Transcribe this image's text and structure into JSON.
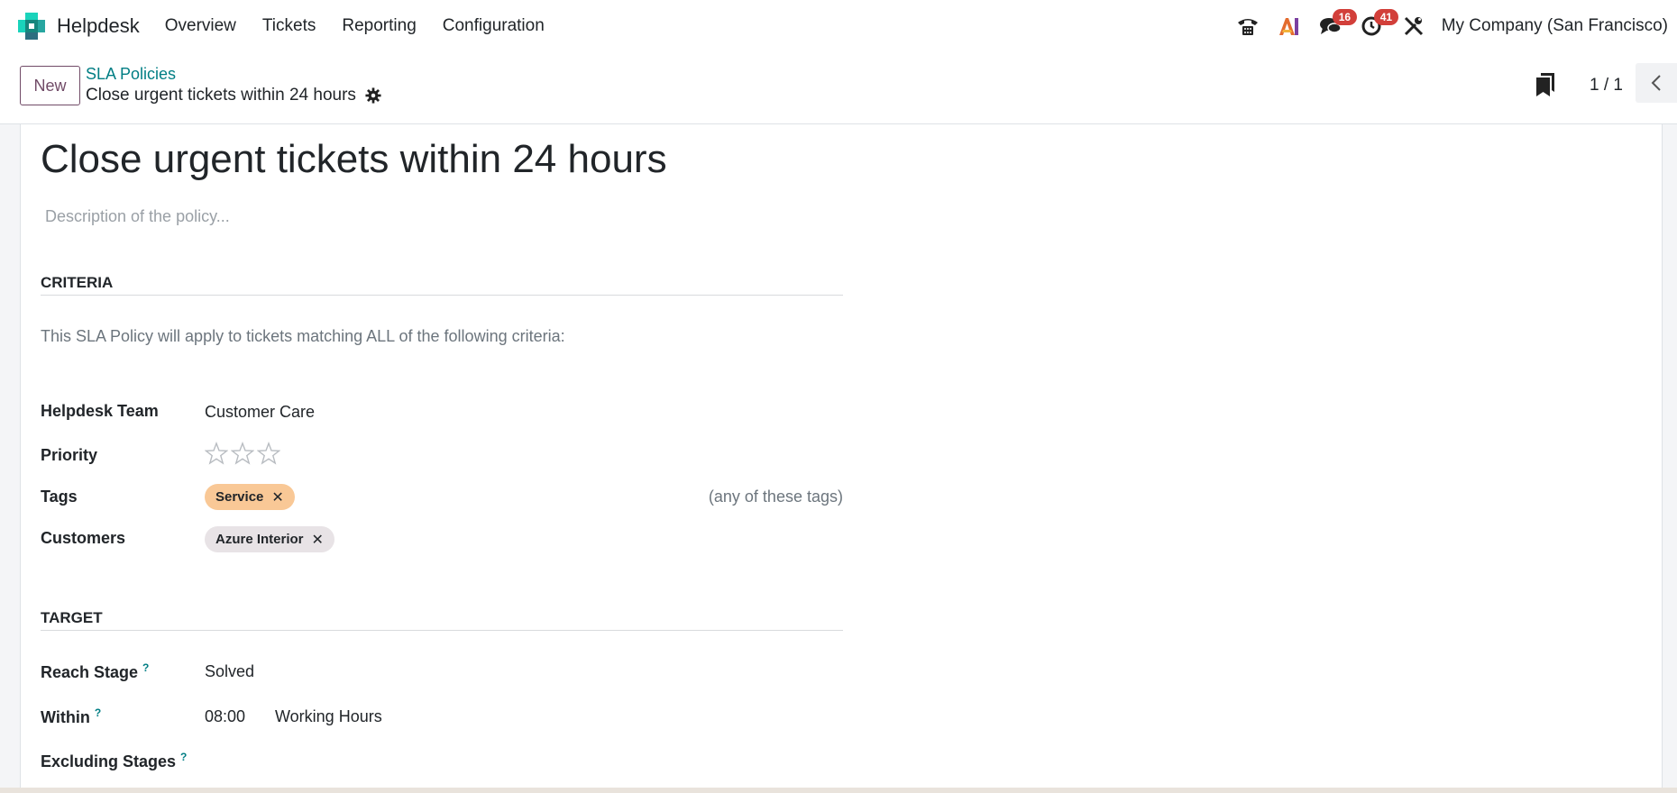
{
  "app": {
    "name": "Helpdesk"
  },
  "menu": [
    "Overview",
    "Tickets",
    "Reporting",
    "Configuration"
  ],
  "systray": {
    "chat_badge": "16",
    "activity_badge": "41",
    "company": "My Company (San Francisco)",
    "icons": [
      "phone-icon",
      "ai-icon",
      "chat-icon",
      "activity-clock-icon",
      "tools-icon"
    ]
  },
  "control": {
    "new_label": "New",
    "breadcrumb_parent": "SLA Policies",
    "breadcrumb_current": "Close urgent tickets within 24 hours",
    "pager": "1 / 1"
  },
  "form": {
    "title": "Close urgent tickets within 24 hours",
    "description_placeholder": "Description of the policy...",
    "criteria": {
      "heading": "CRITERIA",
      "note": "This SLA Policy will apply to tickets matching ALL of the following criteria:",
      "team_label": "Helpdesk Team",
      "team_value": "Customer Care",
      "priority_label": "Priority",
      "priority_stars": 3,
      "priority_value": 0,
      "tags_label": "Tags",
      "tags": [
        {
          "name": "Service",
          "color": "#f9c896"
        }
      ],
      "tags_hint": "(any of these tags)",
      "customers_label": "Customers",
      "customers": [
        {
          "name": "Azure Interior",
          "color": "#e8e3e6"
        }
      ]
    },
    "target": {
      "heading": "TARGET",
      "reach_stage_label": "Reach Stage",
      "reach_stage_value": "Solved",
      "within_label": "Within",
      "within_time": "08:00",
      "within_unit": "Working Hours",
      "excluding_label": "Excluding Stages",
      "help_mark": "?"
    }
  },
  "colors": {
    "brand": "#714b67",
    "link": "#017e84",
    "badge": "#d23f3a"
  }
}
